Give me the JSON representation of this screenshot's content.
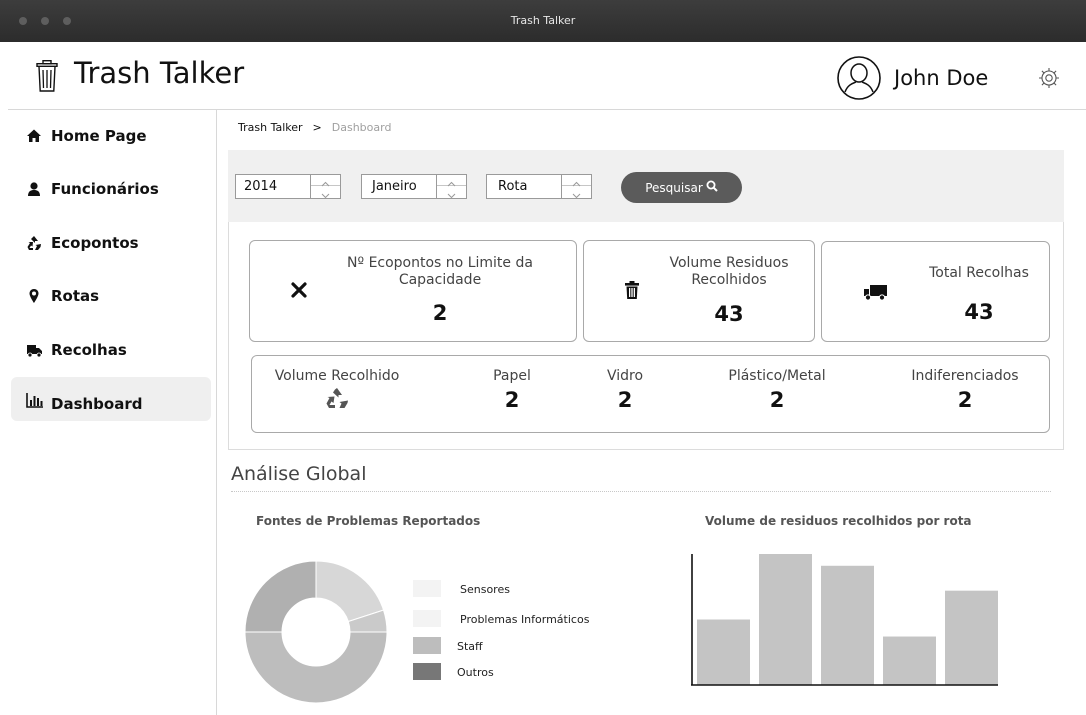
{
  "window": {
    "title": "Trash Talker"
  },
  "header": {
    "app_title": "Trash Talker",
    "user_name": "John Doe"
  },
  "sidebar": {
    "items": [
      {
        "label": "Home Page",
        "icon": "home-icon",
        "active": false
      },
      {
        "label": "Funcionários",
        "icon": "user-icon",
        "active": false
      },
      {
        "label": "Ecopontos",
        "icon": "recycle-icon",
        "active": false
      },
      {
        "label": "Rotas",
        "icon": "map-marker-icon",
        "active": false
      },
      {
        "label": "Recolhas",
        "icon": "truck-icon",
        "active": false
      },
      {
        "label": "Dashboard",
        "icon": "bar-chart-icon",
        "active": true
      }
    ]
  },
  "breadcrumb": {
    "root": "Trash Talker",
    "separator": ">",
    "current": "Dashboard"
  },
  "filters": {
    "year": "2014",
    "month": "Janeiro",
    "route": "Rota",
    "search_label": "Pesquisar"
  },
  "stats": {
    "ecopontos_limit": {
      "label": "Nº Ecopontos no Limite da Capacidade",
      "value": "2",
      "icon": "close-icon"
    },
    "volume_residuos": {
      "label": "Volume Residuos Recolhidos",
      "value": "43",
      "icon": "trash-icon"
    },
    "total_recolhas": {
      "label": "Total Recolhas",
      "value": "43",
      "icon": "truck-icon"
    }
  },
  "volume": {
    "title": "Volume Recolhido",
    "icon": "recycle-icon",
    "categories": [
      {
        "label": "Papel",
        "value": "2"
      },
      {
        "label": "Vidro",
        "value": "2"
      },
      {
        "label": "Plástico/Metal",
        "value": "2"
      },
      {
        "label": "Indiferenciados",
        "value": "2"
      }
    ]
  },
  "analysis": {
    "title": "Análise Global"
  },
  "chart_data": [
    {
      "type": "pie",
      "title": "Fontes de Problemas Reportados",
      "labels": [
        "Sensores",
        "Problemas Informáticos",
        "Staff",
        "Outros"
      ],
      "values": [
        0.2,
        0.05,
        0.5,
        0.25
      ],
      "colors": [
        "#d7d7d7",
        "#cacaca",
        "#bdbdbd",
        "#b0b0b0"
      ],
      "legend_colors": [
        "#f3f3f3",
        "#f3f3f3",
        "#bdbdbd",
        "#777777"
      ],
      "legend": "right"
    },
    {
      "type": "bar",
      "title": "Volume de residuos recolhidos por rota",
      "values": [
        50,
        100,
        91,
        37,
        72
      ],
      "ylim": [
        0,
        100
      ],
      "color": "#c4c4c4"
    }
  ]
}
